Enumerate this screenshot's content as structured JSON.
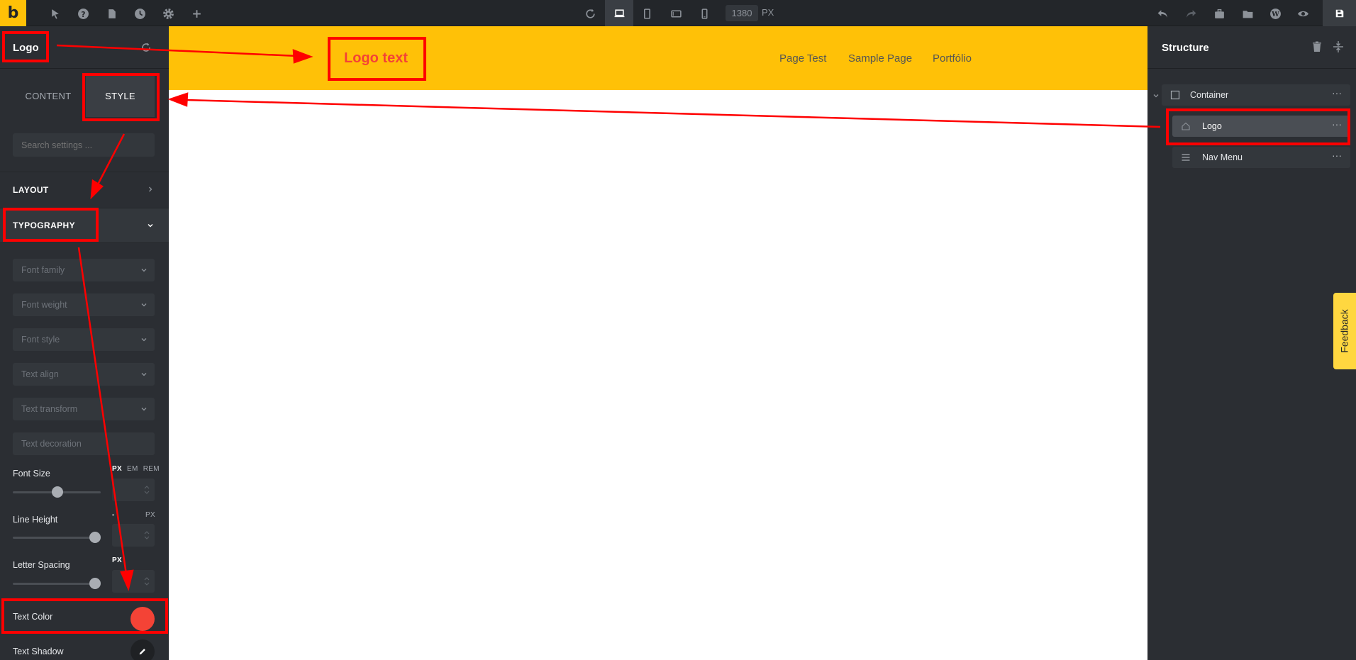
{
  "topbar": {
    "brand_letter": "b",
    "icons": [
      "cursor-icon",
      "help-icon",
      "page-icon",
      "history-icon",
      "settings-icon",
      "plus-icon"
    ],
    "breakpoints": [
      "refresh-icon",
      "desktop-icon",
      "tablet-icon",
      "tablet-landscape-icon",
      "mobile-icon"
    ],
    "width_value": "1380",
    "width_unit": "PX",
    "right_icons": [
      "undo-icon",
      "redo-icon",
      "templates-icon",
      "folder-icon",
      "wordpress-icon",
      "preview-icon",
      "save-icon"
    ]
  },
  "left_panel": {
    "element_title": "Logo",
    "tabs": {
      "content": "CONTENT",
      "style": "STYLE"
    },
    "search_placeholder": "Search settings ...",
    "sections": {
      "layout": "LAYOUT",
      "typography": "TYPOGRAPHY"
    },
    "selects": {
      "font_family": "Font family",
      "font_weight": "Font weight",
      "font_style": "Font style",
      "text_align": "Text align",
      "text_transform": "Text transform",
      "text_decoration": "Text decoration"
    },
    "font_size": {
      "label": "Font Size",
      "units": [
        "PX",
        "EM",
        "REM"
      ],
      "active_unit": "PX",
      "slider": 0.4
    },
    "line_height": {
      "label": "Line Height",
      "unit_left": "-",
      "unit_right": "PX",
      "slider": 0.78
    },
    "letter_spacing": {
      "label": "Letter Spacing",
      "unit": "PX",
      "slider": 0.78
    },
    "text_color": {
      "label": "Text Color",
      "value": "#f44336"
    },
    "text_shadow": {
      "label": "Text Shadow"
    }
  },
  "canvas": {
    "header_bg": "#ffc107",
    "logo_text": "Logo text",
    "nav": [
      "Page Test",
      "Sample Page",
      "Portfólio"
    ]
  },
  "right_panel": {
    "title": "Structure",
    "tree": [
      {
        "label": "Container",
        "icon": "container-icon"
      },
      {
        "label": "Logo",
        "icon": "home-icon"
      },
      {
        "label": "Nav Menu",
        "icon": "menu-icon"
      }
    ]
  },
  "feedback": "Feedback",
  "colors": {
    "accent": "#ffc107",
    "annotation": "#ff0000"
  }
}
